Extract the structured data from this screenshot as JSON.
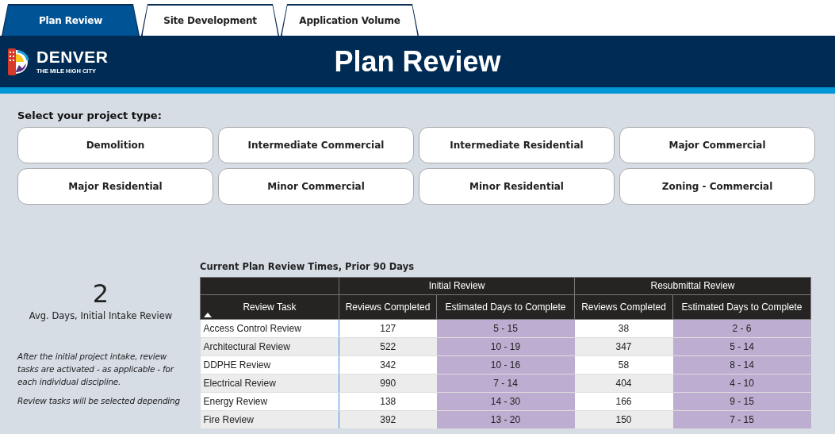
{
  "tabs": [
    {
      "label": "Plan Review",
      "selected": true
    },
    {
      "label": "Site Development",
      "selected": false
    },
    {
      "label": "Application Volume",
      "selected": false
    }
  ],
  "header": {
    "logo_name": "DENVER",
    "logo_tagline": "THE MILE HIGH CITY",
    "title": "Plan Review"
  },
  "project_type": {
    "label": "Select your project type:",
    "options": [
      {
        "label": "Demolition",
        "selected": false
      },
      {
        "label": "Intermediate Commercial",
        "selected": false
      },
      {
        "label": "Intermediate Residential",
        "selected": false
      },
      {
        "label": "Major Commercial",
        "selected": false
      },
      {
        "label": "Major Residential",
        "selected": false
      },
      {
        "label": "Minor Commercial",
        "selected": false
      },
      {
        "label": "Minor Residential",
        "selected": false
      },
      {
        "label": "Zoning - Commercial",
        "selected": false
      }
    ]
  },
  "kpi": {
    "value": "2",
    "label": "Avg. Days, Initial Intake Review"
  },
  "notes": [
    "After the initial project intake, review tasks are activated - as applicable - for each individual discipline.",
    "Review tasks will be selected depending"
  ],
  "table": {
    "title": "Current Plan Review Times, Prior 90 Days",
    "groups": [
      {
        "label": "Initial Review"
      },
      {
        "label": "Resubmittal Review"
      }
    ],
    "columns": [
      {
        "label": "Review Task",
        "sorted": true
      },
      {
        "label": "Reviews Completed",
        "sorted": false
      },
      {
        "label": "Estimated Days to Complete",
        "sorted": false
      },
      {
        "label": "Reviews Completed",
        "sorted": false
      },
      {
        "label": "Estimated Days to Complete",
        "sorted": false
      }
    ],
    "rows": [
      [
        "Access Control Review",
        "127",
        "5 - 15",
        "38",
        "2 - 6"
      ],
      [
        "Architectural Review",
        "522",
        "10 - 19",
        "347",
        "5 - 14"
      ],
      [
        "DDPHE Review",
        "342",
        "10 - 16",
        "58",
        "8 - 14"
      ],
      [
        "Electrical Review",
        "990",
        "7 - 14",
        "404",
        "4 - 10"
      ],
      [
        "Energy Review",
        "138",
        "14 - 30",
        "166",
        "9 - 15"
      ],
      [
        "Fire Review",
        "392",
        "13 - 20",
        "150",
        "7 - 15"
      ]
    ]
  }
}
